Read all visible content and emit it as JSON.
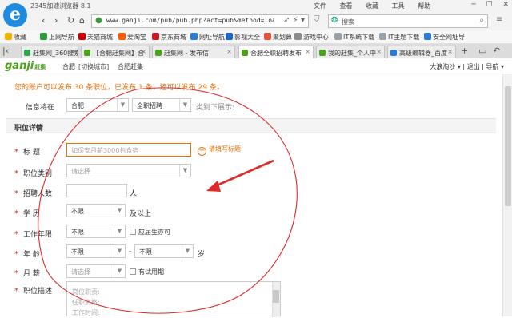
{
  "window": {
    "title": "2345加速浏览器 8.1",
    "menus": [
      "文件",
      "查看",
      "收藏",
      "工具",
      "帮助"
    ]
  },
  "nav": {
    "url": "www.ganji.com/pub/pub.php?act=pub&method=load",
    "search_placeholder": "搜索"
  },
  "bookmarks": [
    {
      "label": "收藏",
      "color": "#f0b400"
    },
    {
      "label": "上网导航",
      "color": "#2a9c3c"
    },
    {
      "label": "天猫商城",
      "color": "#cc0000"
    },
    {
      "label": "爱淘宝",
      "color": "#ff5a00"
    },
    {
      "label": "京东商城",
      "color": "#c81623"
    },
    {
      "label": "网址导航",
      "color": "#2a7ad8"
    },
    {
      "label": "影视大全",
      "color": "#1a66cc"
    },
    {
      "label": "聚划算",
      "color": "#e8543b"
    },
    {
      "label": "游戏中心",
      "color": "#8a8a8a"
    },
    {
      "label": "IT系统下载",
      "color": "#9aa0a8"
    },
    {
      "label": "IT主题下载",
      "color": "#9aa0a8"
    },
    {
      "label": "安全网址导",
      "color": "#2a7ad8"
    }
  ],
  "tabs": [
    {
      "label": "赶集网_360搜索",
      "color": "#2aa84a",
      "active": false
    },
    {
      "label": "【合肥赶集网】合",
      "color": "#4ca31a",
      "active": false
    },
    {
      "label": "赶集网 - 发布信",
      "color": "#4ca31a",
      "active": false
    },
    {
      "label": "合肥全职招聘发布",
      "color": "#4ca31a",
      "active": true
    },
    {
      "label": "我的赶集_个人中",
      "color": "#4ca31a",
      "active": false
    },
    {
      "label": "高级编辑器_百度",
      "color": "#2a7ad8",
      "active": false
    }
  ],
  "site": {
    "logo": "ganji",
    "logo_suffix": "赶集",
    "city": "合肥",
    "switch_city": "[切换城市]",
    "section": "合肥赶集",
    "username": "大浪淘沙",
    "logout": "退出",
    "guide": "导航"
  },
  "notice": "您的账户可以发布 30 条职位，已发布 1 条，还可以发布 29 条。",
  "publish_to": {
    "label": "信息将在",
    "city": "合肥",
    "category": "全职招聘",
    "suffix": "类别下展示:"
  },
  "section_title": "职位详情",
  "form": {
    "title_label": "标   题",
    "title_placeholder": "如保安月薪3000包食宿",
    "title_hint": "请填写标题",
    "category_label": "职位类别",
    "category_value": "请选择",
    "headcount_label": "招聘人数",
    "headcount_unit": "人",
    "education_label": "学   历",
    "education_value": "不限",
    "education_suffix": "及以上",
    "experience_label": "工作年限",
    "experience_value": "不限",
    "fresh_grad": "应届生亦可",
    "age_label": "年   龄",
    "age_from": "不限",
    "age_dash": "-",
    "age_to": "不限",
    "age_unit": "岁",
    "salary_label": "月   薪",
    "salary_value": "请选择",
    "probation": "有试用期",
    "desc_label": "职位描述",
    "desc_lines": [
      "岗位职责:",
      "任职资格:",
      "工作时间:"
    ]
  }
}
